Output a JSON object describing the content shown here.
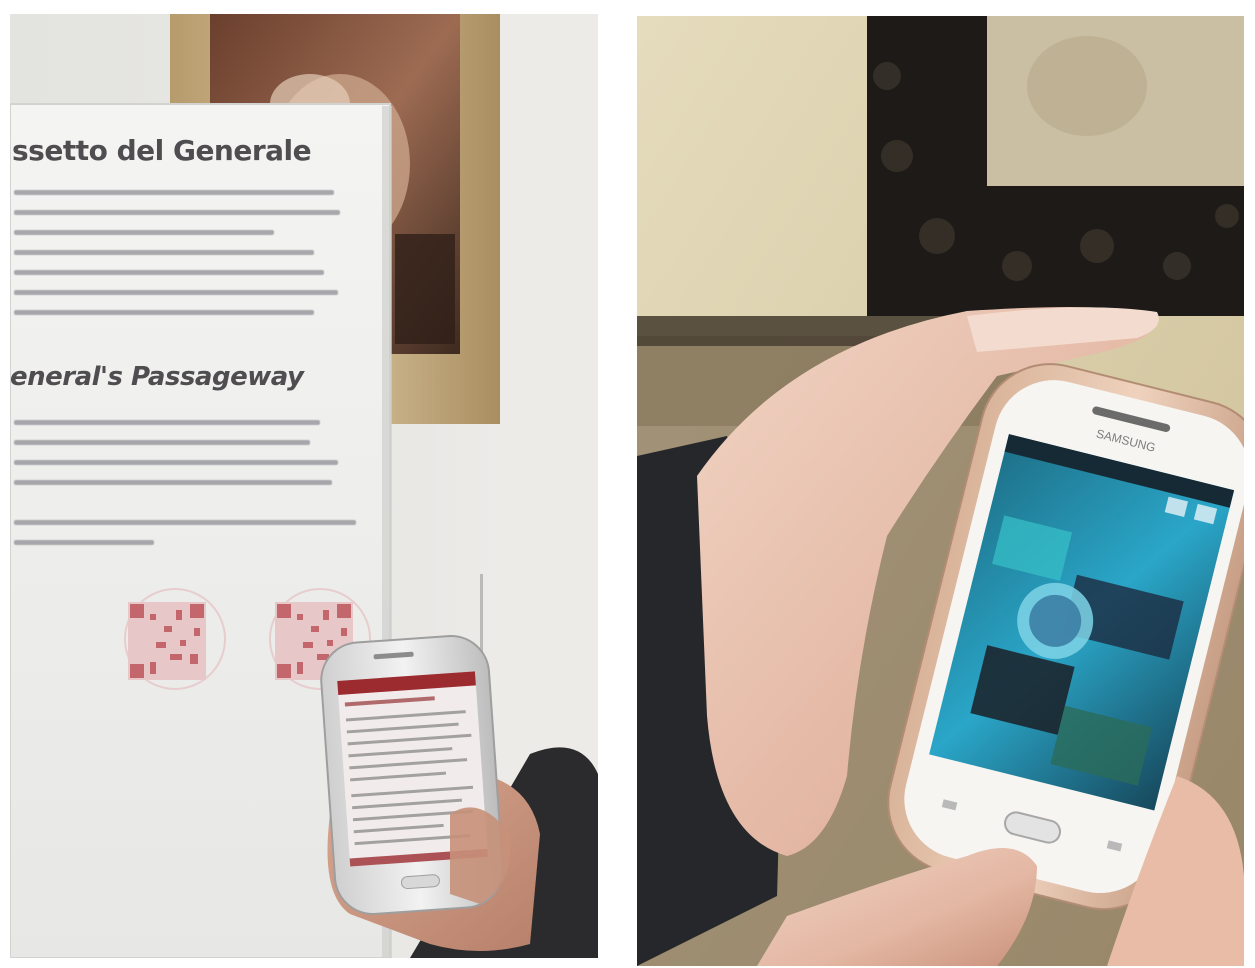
{
  "left_photo": {
    "panel": {
      "title_italian": "ssetto del Generale",
      "title_english": "eneral's Passageway"
    },
    "phone": {
      "screen_color": "#f1eceb",
      "header_color": "#9b2b2f"
    }
  },
  "right_photo": {
    "phone": {
      "brand": "SAMSUNG",
      "screen_color": "#2aa6c8"
    }
  }
}
